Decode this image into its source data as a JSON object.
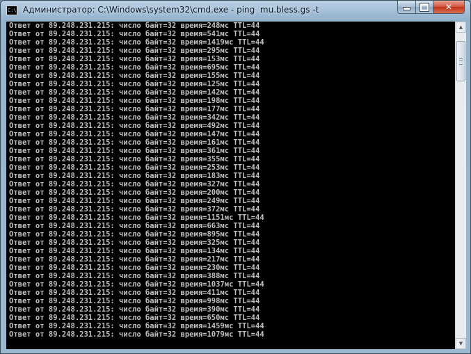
{
  "window": {
    "icon_label": "C:\\",
    "title": "Администратор: C:\\Windows\\system32\\cmd.exe - ping  mu.bless.gs -t"
  },
  "controls": {
    "close_label": "✕"
  },
  "console": {
    "lines": [
      "Ответ от 89.248.231.215: число байт=32 время=248мс TTL=44",
      "Ответ от 89.248.231.215: число байт=32 время=541мс TTL=44",
      "Ответ от 89.248.231.215: число байт=32 время=1419мс TTL=44",
      "Ответ от 89.248.231.215: число байт=32 время=295мс TTL=44",
      "Ответ от 89.248.231.215: число байт=32 время=153мс TTL=44",
      "Ответ от 89.248.231.215: число байт=32 время=695мс TTL=44",
      "Ответ от 89.248.231.215: число байт=32 время=155мс TTL=44",
      "Ответ от 89.248.231.215: число байт=32 время=125мс TTL=44",
      "Ответ от 89.248.231.215: число байт=32 время=142мс TTL=44",
      "Ответ от 89.248.231.215: число байт=32 время=198мс TTL=44",
      "Ответ от 89.248.231.215: число байт=32 время=177мс TTL=44",
      "Ответ от 89.248.231.215: число байт=32 время=342мс TTL=44",
      "Ответ от 89.248.231.215: число байт=32 время=492мс TTL=44",
      "Ответ от 89.248.231.215: число байт=32 время=147мс TTL=44",
      "Ответ от 89.248.231.215: число байт=32 время=161мс TTL=44",
      "Ответ от 89.248.231.215: число байт=32 время=361мс TTL=44",
      "Ответ от 89.248.231.215: число байт=32 время=355мс TTL=44",
      "Ответ от 89.248.231.215: число байт=32 время=253мс TTL=44",
      "Ответ от 89.248.231.215: число байт=32 время=183мс TTL=44",
      "Ответ от 89.248.231.215: число байт=32 время=327мс TTL=44",
      "Ответ от 89.248.231.215: число байт=32 время=200мс TTL=44",
      "Ответ от 89.248.231.215: число байт=32 время=249мс TTL=44",
      "Ответ от 89.248.231.215: число байт=32 время=372мс TTL=44",
      "Ответ от 89.248.231.215: число байт=32 время=1151мс TTL=44",
      "Ответ от 89.248.231.215: число байт=32 время=663мс TTL=44",
      "Ответ от 89.248.231.215: число байт=32 время=895мс TTL=44",
      "Ответ от 89.248.231.215: число байт=32 время=325мс TTL=44",
      "Ответ от 89.248.231.215: число байт=32 время=134мс TTL=44",
      "Ответ от 89.248.231.215: число байт=32 время=217мс TTL=44",
      "Ответ от 89.248.231.215: число байт=32 время=230мс TTL=44",
      "Ответ от 89.248.231.215: число байт=32 время=388мс TTL=44",
      "Ответ от 89.248.231.215: число байт=32 время=1037мс TTL=44",
      "Ответ от 89.248.231.215: число байт=32 время=411мс TTL=44",
      "Ответ от 89.248.231.215: число байт=32 время=998мс TTL=44",
      "Ответ от 89.248.231.215: число байт=32 время=390мс TTL=44",
      "Ответ от 89.248.231.215: число байт=32 время=650мс TTL=44",
      "Ответ от 89.248.231.215: число байт=32 время=1459мс TTL=44",
      "Ответ от 89.248.231.215: число байт=32 время=1079мс TTL=44"
    ],
    "text_color": "#c0c0c0",
    "background_color": "#000000"
  }
}
